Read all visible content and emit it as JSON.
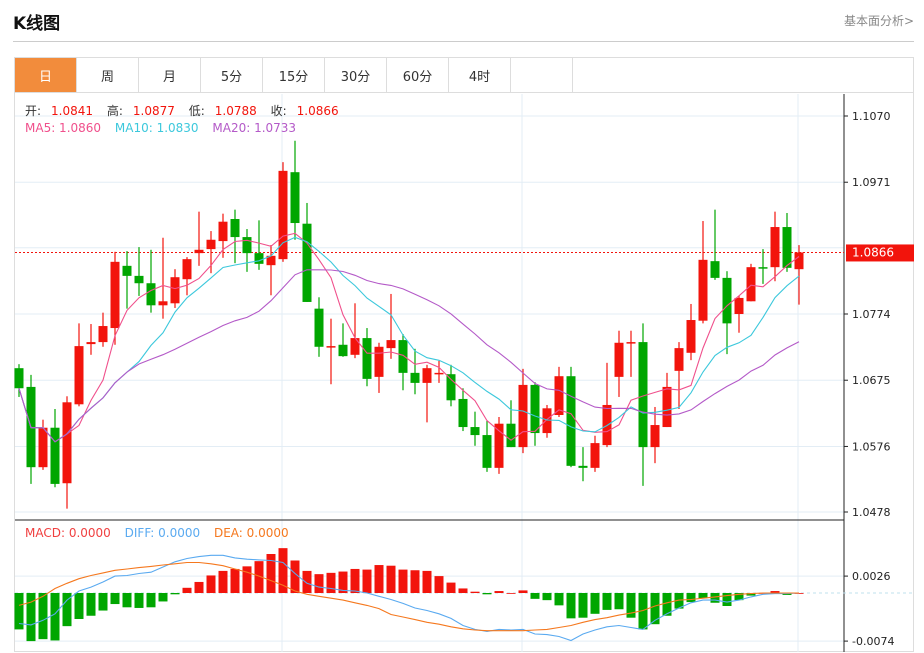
{
  "header": {
    "title": "K线图",
    "link": "基本面分析>"
  },
  "tabs": [
    {
      "label": "日",
      "active": true
    },
    {
      "label": "周"
    },
    {
      "label": "月"
    },
    {
      "label": "5分"
    },
    {
      "label": "15分"
    },
    {
      "label": "30分"
    },
    {
      "label": "60分"
    },
    {
      "label": "4时"
    }
  ],
  "ohlc_legend": {
    "open_label": "开:",
    "open": "1.0841",
    "high_label": "高:",
    "high": "1.0877",
    "low_label": "低:",
    "low": "1.0788",
    "close_label": "收:",
    "close": "1.0866"
  },
  "ma_legend": {
    "ma5": "MA5: 1.0860",
    "ma10": "MA10: 1.0830",
    "ma20": "MA20: 1.0733"
  },
  "macd_legend": {
    "macd": "MACD: 0.0000",
    "diff": "DIFF: 0.0000",
    "dea": "DEA: 0.0000"
  },
  "colors": {
    "up": "#f2140c",
    "down": "#00a600",
    "ma5": "#f0508c",
    "ma10": "#3cc8dc",
    "ma20": "#b45ac8",
    "diff": "#5aaaf0",
    "dea": "#f5781e",
    "accent": "#f28c3c"
  },
  "chart_data": {
    "type": "candlestick",
    "price_axis": {
      "ticks": [
        "1.1070",
        "1.0971",
        "1.0774",
        "1.0675",
        "1.0576",
        "1.0478"
      ],
      "range": [
        1.0478,
        1.107
      ]
    },
    "current_price": "1.0866",
    "candles": [
      [
        1.0693,
        1.0699,
        1.065,
        1.0663
      ],
      [
        1.0665,
        1.0683,
        1.052,
        1.0545
      ],
      [
        1.0545,
        1.0616,
        1.0541,
        1.0604
      ],
      [
        1.0604,
        1.0632,
        1.0515,
        1.052
      ],
      [
        1.0521,
        1.0651,
        1.0483,
        1.0642
      ],
      [
        1.0639,
        1.076,
        1.0636,
        1.0726
      ],
      [
        1.0729,
        1.0759,
        1.0713,
        1.0732
      ],
      [
        1.0732,
        1.0776,
        1.0725,
        1.0756
      ],
      [
        1.0753,
        1.0867,
        1.0728,
        1.0852
      ],
      [
        1.0846,
        1.0868,
        1.0782,
        1.0831
      ],
      [
        1.0831,
        1.0874,
        1.0801,
        1.082
      ],
      [
        1.082,
        1.087,
        1.0776,
        1.0787
      ],
      [
        1.0787,
        1.0888,
        1.0767,
        1.0793
      ],
      [
        1.079,
        1.0841,
        1.0783,
        1.0829
      ],
      [
        1.0826,
        1.0859,
        1.0802,
        1.0856
      ],
      [
        1.0865,
        1.0927,
        1.0846,
        1.087
      ],
      [
        1.0871,
        1.0898,
        1.0835,
        1.0885
      ],
      [
        1.0883,
        1.0924,
        1.0858,
        1.0912
      ],
      [
        1.0916,
        1.093,
        1.085,
        1.0889
      ],
      [
        1.0889,
        1.0901,
        1.0837,
        1.0865
      ],
      [
        1.0865,
        1.0914,
        1.084,
        1.0849
      ],
      [
        1.0847,
        1.0877,
        1.0802,
        1.0861
      ],
      [
        1.0856,
        1.1001,
        1.0852,
        1.0988
      ],
      [
        1.0986,
        1.1033,
        1.0885,
        1.091
      ],
      [
        1.0909,
        1.094,
        1.0792,
        1.0792
      ],
      [
        1.0782,
        1.0799,
        1.071,
        1.0725
      ],
      [
        1.0725,
        1.0767,
        1.0669,
        1.0726
      ],
      [
        1.0728,
        1.076,
        1.071,
        1.0711
      ],
      [
        1.0713,
        1.079,
        1.0708,
        1.0738
      ],
      [
        1.0738,
        1.0753,
        1.0666,
        1.0677
      ],
      [
        1.068,
        1.0731,
        1.0656,
        1.0725
      ],
      [
        1.0723,
        1.0804,
        1.0707,
        1.0735
      ],
      [
        1.0735,
        1.0744,
        1.066,
        1.0686
      ],
      [
        1.0686,
        1.0722,
        1.0654,
        1.0671
      ],
      [
        1.0671,
        1.0698,
        1.0612,
        1.0693
      ],
      [
        1.0684,
        1.0704,
        1.0671,
        1.0686
      ],
      [
        1.0684,
        1.0698,
        1.0636,
        1.0645
      ],
      [
        1.0647,
        1.0663,
        1.0599,
        1.0605
      ],
      [
        1.0605,
        1.0628,
        1.0577,
        1.0593
      ],
      [
        1.0593,
        1.0614,
        1.0538,
        1.0544
      ],
      [
        1.0544,
        1.062,
        1.0535,
        1.061
      ],
      [
        1.061,
        1.0645,
        1.0575,
        1.0575
      ],
      [
        1.0575,
        1.0692,
        1.0566,
        1.0668
      ],
      [
        1.0668,
        1.0672,
        1.0577,
        1.0596
      ],
      [
        1.0596,
        1.0638,
        1.0589,
        1.0633
      ],
      [
        1.0623,
        1.0695,
        1.062,
        1.0681
      ],
      [
        1.0681,
        1.0695,
        1.0545,
        1.0547
      ],
      [
        1.0547,
        1.0575,
        1.0524,
        1.0544
      ],
      [
        1.0544,
        1.0592,
        1.0538,
        1.0581
      ],
      [
        1.0578,
        1.0701,
        1.0575,
        1.0638
      ],
      [
        1.068,
        1.0749,
        1.065,
        1.0731
      ],
      [
        1.0731,
        1.0749,
        1.068,
        1.0732
      ],
      [
        1.0732,
        1.076,
        1.0517,
        1.0575
      ],
      [
        1.0575,
        1.0635,
        1.0551,
        1.0608
      ],
      [
        1.0605,
        1.0686,
        1.0605,
        1.0665
      ],
      [
        1.0689,
        1.0732,
        1.0632,
        1.0723
      ],
      [
        1.0716,
        1.0789,
        1.0705,
        1.0765
      ],
      [
        1.0764,
        1.0913,
        1.076,
        1.0855
      ],
      [
        1.0853,
        1.093,
        1.0825,
        1.0828
      ],
      [
        1.0828,
        1.0838,
        1.0714,
        1.076
      ],
      [
        1.0774,
        1.0801,
        1.0746,
        1.0798
      ],
      [
        1.0793,
        1.0849,
        1.0793,
        1.0844
      ],
      [
        1.0844,
        1.0871,
        1.0819,
        1.0843
      ],
      [
        1.0844,
        1.0927,
        1.0823,
        1.0904
      ],
      [
        1.0904,
        1.0925,
        1.0837,
        1.0843
      ],
      [
        1.0841,
        1.0877,
        1.0788,
        1.0866
      ]
    ],
    "candle_format": [
      "open",
      "high",
      "low",
      "close"
    ],
    "macd_axis": {
      "ticks": [
        "0.0026",
        "-0.0074"
      ]
    },
    "macd_hist": [
      -0.0056,
      -0.0074,
      -0.0071,
      -0.0073,
      -0.0051,
      -0.004,
      -0.0035,
      -0.0027,
      -0.0017,
      -0.0022,
      -0.0023,
      -0.0022,
      -0.0013,
      -0.0002,
      0.0008,
      0.0017,
      0.0027,
      0.0034,
      0.0037,
      0.0041,
      0.0049,
      0.006,
      0.0069,
      0.005,
      0.0034,
      0.0029,
      0.0031,
      0.0033,
      0.0037,
      0.0036,
      0.0043,
      0.0042,
      0.0036,
      0.0035,
      0.0034,
      0.0026,
      0.0016,
      0.0007,
      0.0002,
      -0.0002,
      0.0003,
      0.0,
      0.0004,
      -0.0009,
      -0.0011,
      -0.0019,
      -0.0039,
      -0.0038,
      -0.0032,
      -0.0026,
      -0.0025,
      -0.0038,
      -0.0056,
      -0.0048,
      -0.0035,
      -0.0024,
      -0.0014,
      -0.0008,
      -0.0015,
      -0.002,
      -0.0011,
      -0.0004,
      0.0,
      0.0003,
      -0.0003,
      0.0
    ],
    "diff": [
      -0.0047,
      -0.0049,
      -0.0042,
      -0.0032,
      -0.0011,
      0.0003,
      0.0009,
      0.0017,
      0.0026,
      0.0027,
      0.003,
      0.0032,
      0.004,
      0.0048,
      0.0053,
      0.0056,
      0.0058,
      0.0058,
      0.0054,
      0.0052,
      0.0051,
      0.005,
      0.0047,
      0.003,
      0.0015,
      0.0009,
      0.0007,
      0.0004,
      0.0003,
      0.0,
      -0.0005,
      -0.001,
      -0.0016,
      -0.0023,
      -0.0027,
      -0.0032,
      -0.0039,
      -0.005,
      -0.0056,
      -0.0059,
      -0.0056,
      -0.0057,
      -0.0056,
      -0.0063,
      -0.0064,
      -0.0067,
      -0.0073,
      -0.0063,
      -0.0057,
      -0.0052,
      -0.005,
      -0.0053,
      -0.0056,
      -0.0042,
      -0.0032,
      -0.0023,
      -0.0015,
      -0.0011,
      -0.0011,
      -0.0014,
      -0.0011,
      -0.0006,
      -0.0002,
      -0.0001,
      -0.0001,
      0.0
    ],
    "dea": [
      -0.0019,
      -0.0014,
      -0.0005,
      0.0007,
      0.0015,
      0.0022,
      0.0027,
      0.0031,
      0.0035,
      0.0037,
      0.0039,
      0.0041,
      0.0043,
      0.0045,
      0.0047,
      0.0047,
      0.0045,
      0.0042,
      0.0037,
      0.0032,
      0.0026,
      0.0019,
      0.0012,
      0.0003,
      -0.0002,
      -0.0005,
      -0.0008,
      -0.0011,
      -0.0015,
      -0.0019,
      -0.0024,
      -0.0033,
      -0.0037,
      -0.0041,
      -0.0045,
      -0.0048,
      -0.0052,
      -0.0055,
      -0.0057,
      -0.0058,
      -0.0058,
      -0.0058,
      -0.0058,
      -0.0057,
      -0.0056,
      -0.0053,
      -0.005,
      -0.0045,
      -0.0041,
      -0.0038,
      -0.0034,
      -0.0031,
      -0.0027,
      -0.002,
      -0.0015,
      -0.0011,
      -0.001,
      -0.0008,
      -0.0006,
      -0.0004,
      -0.0002,
      -0.0001,
      0.0,
      0.0,
      0.0,
      0.0
    ]
  }
}
